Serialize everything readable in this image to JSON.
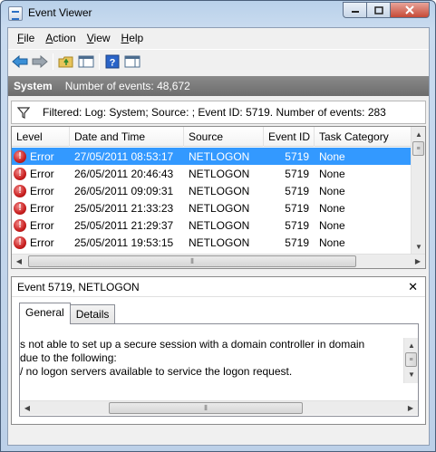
{
  "window": {
    "title": "Event Viewer"
  },
  "menu": [
    {
      "mnemonic": "F",
      "rest": "ile"
    },
    {
      "mnemonic": "A",
      "rest": "ction"
    },
    {
      "mnemonic": "V",
      "rest": "iew"
    },
    {
      "mnemonic": "H",
      "rest": "elp"
    }
  ],
  "toolbar": {
    "icons": [
      "back-arrow-icon",
      "forward-arrow-icon",
      "up-folder-icon",
      "show-hide-console-tree-icon",
      "help-icon",
      "show-hide-action-pane-icon"
    ]
  },
  "log_header": {
    "title": "System",
    "count_text": "Number of events: 48,672"
  },
  "filter": {
    "text": "Filtered: Log: System; Source: ; Event ID: 5719. Number of events: 283"
  },
  "grid": {
    "columns": [
      "Level",
      "Date and Time",
      "Source",
      "Event ID",
      "Task Category"
    ],
    "rows": [
      {
        "level": "Error",
        "datetime": "27/05/2011 08:53:17",
        "source": "NETLOGON",
        "event_id": "5719",
        "category": "None",
        "selected": true
      },
      {
        "level": "Error",
        "datetime": "26/05/2011 20:46:43",
        "source": "NETLOGON",
        "event_id": "5719",
        "category": "None",
        "selected": false
      },
      {
        "level": "Error",
        "datetime": "26/05/2011 09:09:31",
        "source": "NETLOGON",
        "event_id": "5719",
        "category": "None",
        "selected": false
      },
      {
        "level": "Error",
        "datetime": "25/05/2011 21:33:23",
        "source": "NETLOGON",
        "event_id": "5719",
        "category": "None",
        "selected": false
      },
      {
        "level": "Error",
        "datetime": "25/05/2011 21:29:37",
        "source": "NETLOGON",
        "event_id": "5719",
        "category": "None",
        "selected": false
      },
      {
        "level": "Error",
        "datetime": "25/05/2011 19:53:15",
        "source": "NETLOGON",
        "event_id": "5719",
        "category": "None",
        "selected": false
      }
    ]
  },
  "detail": {
    "title": "Event 5719, NETLOGON",
    "close_glyph": "✕",
    "tabs": [
      "General",
      "Details"
    ],
    "active_tab": "General",
    "description_lines": [
      "s not able to set up a secure session with a domain controller in domain",
      "due to the following:",
      "/ no logon servers available to service the logon request."
    ]
  },
  "colors": {
    "selection": "#3399ff",
    "header_bar": "#7a7a7a",
    "error_red": "#c81e1e"
  }
}
